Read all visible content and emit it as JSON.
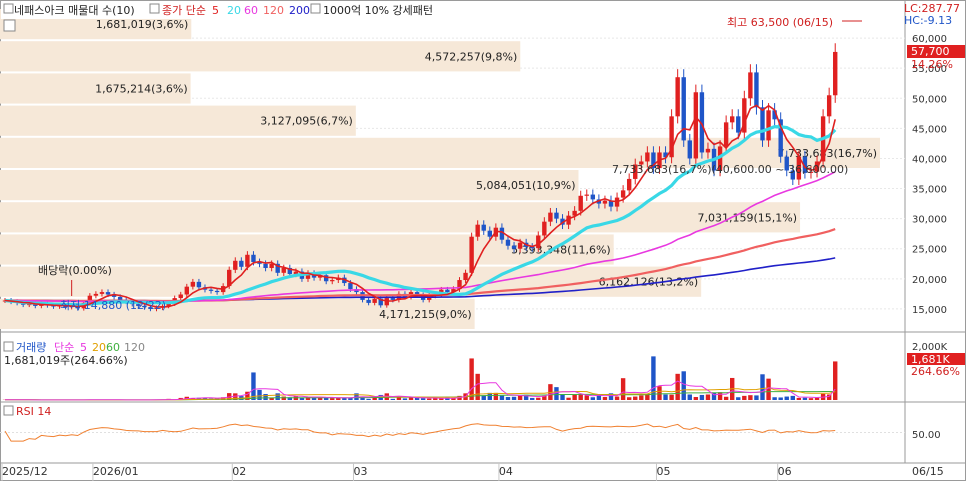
{
  "colors": {
    "up": "#e02020",
    "down": "#1f55c8",
    "ma5": "#e02020",
    "ma20": "#39d8e6",
    "ma60": "#e838e0",
    "ma120": "#f06060",
    "ma200": "#2020c8",
    "rsi": "#f08030",
    "volma5": "#e838e0",
    "volma20": "#e0a000",
    "volma60": "#40b040",
    "profile": "#f6e8d8"
  },
  "header": {
    "title": "네패스아크 매물대 수(10)",
    "ma_label": "종가 단순",
    "ma_periods": [
      "5",
      "20",
      "60",
      "120",
      "200"
    ],
    "extra": "1000억 10% 강세패턴"
  },
  "right_labels": {
    "lc": "LC:287.77",
    "hc": "HC:-9.13",
    "last_price": "57,700",
    "change": "14.26%"
  },
  "volume_panel": {
    "title": "거래량",
    "ma_label": "단순",
    "ma_periods": [
      "5",
      "20",
      "60",
      "120"
    ],
    "info": "1,681,019주(264.66%)",
    "last_value": "1,681K",
    "last_pct": "264.66%",
    "tick": "2,000K"
  },
  "rsi_panel": {
    "title": "RSI 14",
    "tick": "50.00"
  },
  "chart_data": {
    "type": "candlestick",
    "price_axis": {
      "ylim": [
        11500,
        65000
      ],
      "ticks": [
        15000,
        20000,
        25000,
        30000,
        35000,
        40000,
        45000,
        50000,
        55000,
        60000
      ],
      "tick_labels": [
        "15,000",
        "20,000",
        "25,000",
        "30,000",
        "35,000",
        "40,000",
        "45,000",
        "50,000",
        "55,000",
        "60,000"
      ]
    },
    "x_labels": [
      {
        "label": "2025/12",
        "bar": 0
      },
      {
        "label": "2026/01",
        "bar": 15
      },
      {
        "label": "02",
        "bar": 38
      },
      {
        "label": "03",
        "bar": 58
      },
      {
        "label": "04",
        "bar": 82
      },
      {
        "label": "05",
        "bar": 108
      },
      {
        "label": "06",
        "bar": 128
      },
      {
        "label": "06/15",
        "bar": 145
      }
    ],
    "annotations": {
      "high": {
        "text": "최고 63,500 (06/15)",
        "bar": 137,
        "price": 63500
      },
      "low": {
        "text": "최저 14,880 (12/22)",
        "bar": 12,
        "price": 14880
      },
      "dividend": {
        "text": "배당락(0.00%)",
        "bar": 11
      },
      "overlay": {
        "text": "7,733,683(16,7%)(40,600.00 ~ 36,600.00)",
        "price": 38600
      }
    },
    "volume_profile": {
      "range": [
        11500,
        65000
      ],
      "bins": [
        {
          "text": "4,171,215(9,0%)",
          "value": 4171215
        },
        {
          "text": "6,162,126(13,2%)",
          "value": 6162126
        },
        {
          "text": "5,393,348(11,6%)",
          "value": 5393348
        },
        {
          "text": "7,031,159(15,1%)",
          "value": 7031159
        },
        {
          "text": "5,084,051(10,9%)",
          "value": 5084051
        },
        {
          "text": "7,733,683(16,7%)",
          "value": 7733683
        },
        {
          "text": "3,127,095(6,7%)",
          "value": 3127095
        },
        {
          "text": "1,675,214(3,6%)",
          "value": 1675214
        },
        {
          "text": "4,572,257(9,8%)",
          "value": 4572257
        },
        {
          "text": "1,681,019(3,6%)",
          "value": 1681019
        }
      ]
    },
    "closes": [
      16400,
      16200,
      16000,
      15700,
      15800,
      15500,
      15800,
      15600,
      15400,
      15600,
      15300,
      15500,
      15100,
      16000,
      17200,
      17500,
      17800,
      17400,
      17000,
      16500,
      16200,
      15800,
      15500,
      15300,
      15000,
      15200,
      15500,
      15900,
      16800,
      17400,
      18700,
      19500,
      18600,
      18200,
      18000,
      17800,
      18800,
      21500,
      23000,
      22000,
      24000,
      22800,
      22500,
      21800,
      22500,
      21000,
      21800,
      20800,
      21200,
      20000,
      20900,
      20200,
      20600,
      19600,
      19800,
      20200,
      19300,
      18300,
      17800,
      16500,
      16000,
      16700,
      15600,
      16800,
      16500,
      17500,
      17000,
      17800,
      17300,
      16500,
      17200,
      17400,
      18200,
      17800,
      18300,
      19800,
      21000,
      27000,
      29000,
      28000,
      27000,
      28500,
      26500,
      25500,
      25000,
      26000,
      25300,
      25100,
      27200,
      29500,
      31000,
      30000,
      29000,
      30500,
      31300,
      33800,
      34000,
      33200,
      32500,
      33000,
      32000,
      33500,
      34700,
      36600,
      39000,
      39500,
      41000,
      38400,
      41000,
      40200,
      47000,
      53500,
      43000,
      40000,
      51000,
      41000,
      41600,
      38000,
      42000,
      46000,
      47000,
      44300,
      50000,
      54300,
      48500,
      43000,
      48000,
      46500,
      40300,
      38000,
      36500,
      40300,
      37600,
      37800,
      39500,
      47000,
      50500,
      57700
    ],
    "volume_axis": {
      "ylim": [
        0,
        2700000
      ]
    },
    "volumes": [
      0.01,
      0.008,
      0.006,
      0.005,
      0.005,
      0.006,
      0.004,
      0.005,
      0.005,
      0.004,
      0.006,
      0.006,
      0.007,
      0.007,
      0.009,
      0.009,
      0.007,
      0.008,
      0.006,
      0.005,
      0.006,
      0.007,
      0.007,
      0.006,
      0.006,
      0.008,
      0.009,
      0.05,
      0.01,
      0.09,
      0.14,
      0.08,
      0.1,
      0.09,
      0.07,
      0.07,
      0.12,
      0.3,
      0.29,
      0.17,
      0.36,
      1.2,
      0.44,
      0.26,
      0.11,
      0.29,
      0.15,
      0.12,
      0.17,
      0.1,
      0.14,
      0.13,
      0.12,
      0.09,
      0.08,
      0.09,
      0.1,
      0.1,
      0.29,
      0.13,
      0.05,
      0.16,
      0.22,
      0.29,
      0.05,
      0.14,
      0.07,
      0.12,
      0.1,
      0.08,
      0.06,
      0.08,
      0.07,
      0.1,
      0.09,
      0.18,
      0.29,
      1.81,
      1.14,
      0.2,
      0.31,
      0.31,
      0.19,
      0.13,
      0.14,
      0.21,
      0.23,
      0.09,
      0.1,
      0.18,
      0.69,
      0.56,
      0.25,
      0.1,
      0.25,
      0.24,
      0.2,
      0.12,
      0.23,
      0.13,
      0.29,
      0.15,
      0.95,
      0.12,
      0.15,
      0.2,
      0.28,
      1.9,
      0.6,
      0.24,
      0.23,
      1.14,
      1.25,
      0.24,
      0.13,
      0.22,
      0.24,
      0.31,
      0.34,
      0.14,
      0.96,
      0.12,
      0.18,
      0.21,
      0.2,
      1.12,
      0.93,
      0.12,
      0.11,
      0.15,
      0.18,
      0.09,
      0.1,
      0.08,
      0.1,
      0.27,
      0.24,
      1.68
    ],
    "rsi_axis": {
      "ylim": [
        0,
        100
      ],
      "ticks": [
        50
      ]
    }
  }
}
